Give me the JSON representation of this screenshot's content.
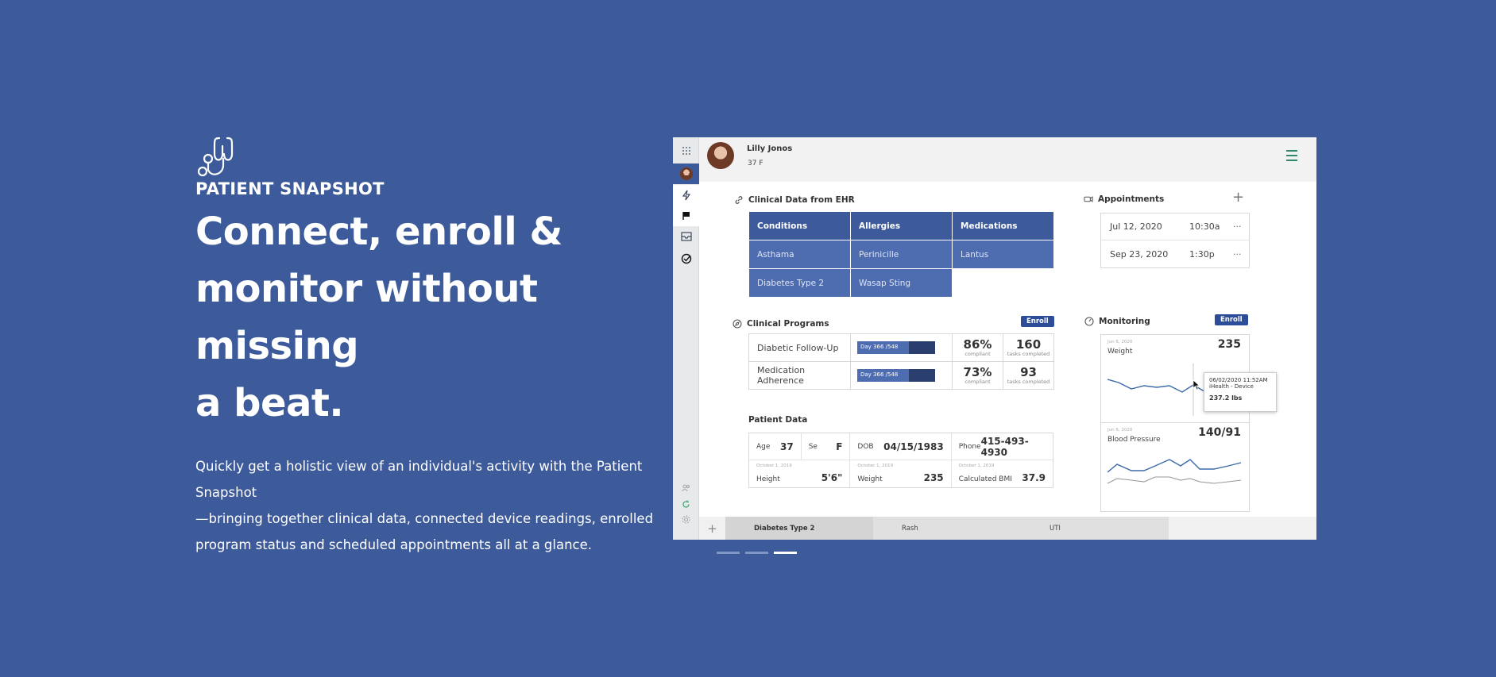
{
  "hero": {
    "icon": "stethoscope-icon",
    "eyebrow": "PATIENT SNAPSHOT",
    "headline_lines": [
      "Connect, enroll &",
      "monitor without missing",
      "a beat."
    ],
    "description_lines": [
      "Quickly get a holistic view of an individual's activity with the Patient Snapshot",
      "—bringing together clinical data, connected device readings, enrolled",
      "program status and scheduled appointments all at a glance."
    ]
  },
  "app": {
    "patient": {
      "name": "Lilly Jonos",
      "meta": "37 F"
    },
    "rail_icons": [
      "apps-grid-icon",
      "avatar-icon",
      "lightning-icon",
      "flag-icon",
      "inbox-icon",
      "check-circle-icon",
      "users-icon",
      "refresh-icon",
      "settings-icon"
    ],
    "ehr": {
      "title": "Clinical Data from EHR",
      "headers": [
        "Conditions",
        "Allergies",
        "Medications"
      ],
      "rows": [
        [
          "Asthama",
          "Perinicille",
          "Lantus"
        ],
        [
          "Diabetes Type 2",
          "Wasap Sting",
          ""
        ]
      ]
    },
    "appointments": {
      "title": "Appointments",
      "add": "+",
      "items": [
        {
          "date": "Jul 12, 2020",
          "time": "10:30a",
          "more": "···"
        },
        {
          "date": "Sep 23, 2020",
          "time": "1:30p",
          "more": "···"
        }
      ]
    },
    "programs": {
      "title": "Clinical Programs",
      "enroll": "Enroll",
      "items": [
        {
          "name": "Diabetic Follow-Up",
          "progress_label": "Day 366 /548",
          "progress": 0.668,
          "compliance": "86%",
          "compliance_label": "compliant",
          "tasks": "160",
          "tasks_label": "tasks completed"
        },
        {
          "name": "Medication Adherence",
          "progress_label": "Day 366 /548",
          "progress": 0.668,
          "compliance": "73%",
          "compliance_label": "compliant",
          "tasks": "93",
          "tasks_label": "tasks completed"
        }
      ]
    },
    "patient_data": {
      "title": "Patient Data",
      "age_label": "Age",
      "age": "37",
      "sex_label": "Se",
      "sex": "F",
      "dob_label": "DOB",
      "dob": "04/15/1983",
      "phone_label": "Phone",
      "phone": "415-493-4930",
      "height_date": "October 1, 2019",
      "height_label": "Height",
      "height": "5'6\"",
      "weight_date": "October 1, 2019",
      "weight_label": "Weight",
      "weight": "235",
      "bmi_date": "October 1, 2019",
      "bmi_label": "Calculated BMI",
      "bmi": "37.9"
    },
    "monitoring": {
      "title": "Monitoring",
      "enroll": "Enroll",
      "cards": [
        {
          "date": "Jun 6, 2020",
          "label": "Weight",
          "value": "235"
        },
        {
          "date": "Jun 6, 2020",
          "label": "Blood Pressure",
          "value": "140/91"
        }
      ],
      "tooltip": {
        "datetime": "06/02/2020  11:52AM",
        "source": "iHealth - Device",
        "value": "237.2 lbs"
      }
    },
    "tabs": {
      "add": "+",
      "items": [
        "Diabetes Type 2",
        "Rash",
        "UTI"
      ]
    }
  },
  "carousel": {
    "count": 3,
    "active": 2
  },
  "colors": {
    "background": "#3d5a9b",
    "accent": "#2e4d98",
    "table_fill": "#4e6cb0",
    "menu_green": "#2e8a6f"
  }
}
